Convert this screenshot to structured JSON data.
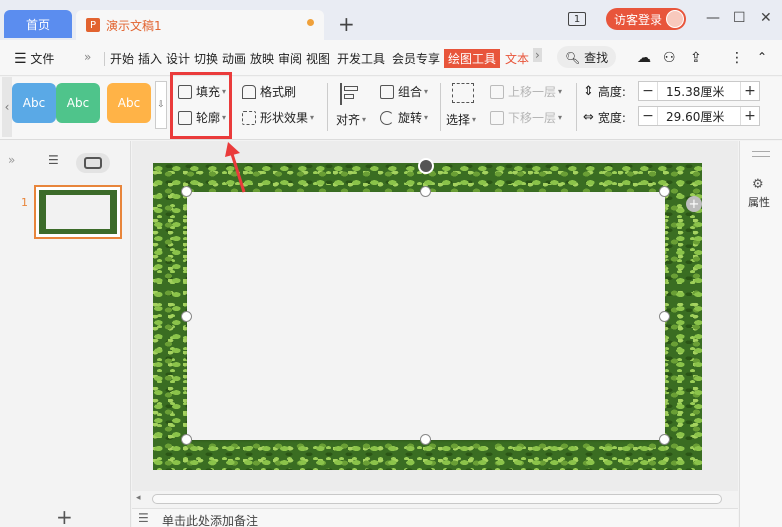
{
  "titlebar": {
    "home_tab": "首页",
    "doc_icon": "P",
    "doc_tab": "演示文稿1",
    "new_tab": "+",
    "page_indicator": "1",
    "login_label": "访客登录",
    "minimize": "—",
    "maximize": "☐",
    "close": "✕"
  },
  "menubar": {
    "file": "文件",
    "more": "»",
    "items": [
      "开始",
      "插入",
      "设计",
      "切换",
      "动画",
      "放映",
      "审阅",
      "视图",
      "开发工具",
      "会员专享"
    ],
    "active_tab": "绘图工具",
    "text_tab": "文本",
    "search": "查找"
  },
  "ribbon": {
    "styles": [
      "Abc",
      "Abc",
      "Abc"
    ],
    "style_colors": [
      "#5aa9e6",
      "#4fc48b",
      "#ffb347"
    ],
    "fill": "填充",
    "outline": "轮廓",
    "format_painter": "格式刷",
    "shape_effects": "形状效果",
    "align": "对齐",
    "group": "组合",
    "rotate": "旋转",
    "select": "选择",
    "bring_forward": "上移一层",
    "send_backward": "下移一层",
    "height_label": "高度:",
    "height_value": "15.38厘米",
    "width_label": "宽度:",
    "width_value": "29.60厘米"
  },
  "left_panel": {
    "slide_number": "1",
    "add_slide": "+"
  },
  "right_panel": {
    "properties": "属性"
  },
  "notes": {
    "placeholder": "单击此处添加备注"
  }
}
